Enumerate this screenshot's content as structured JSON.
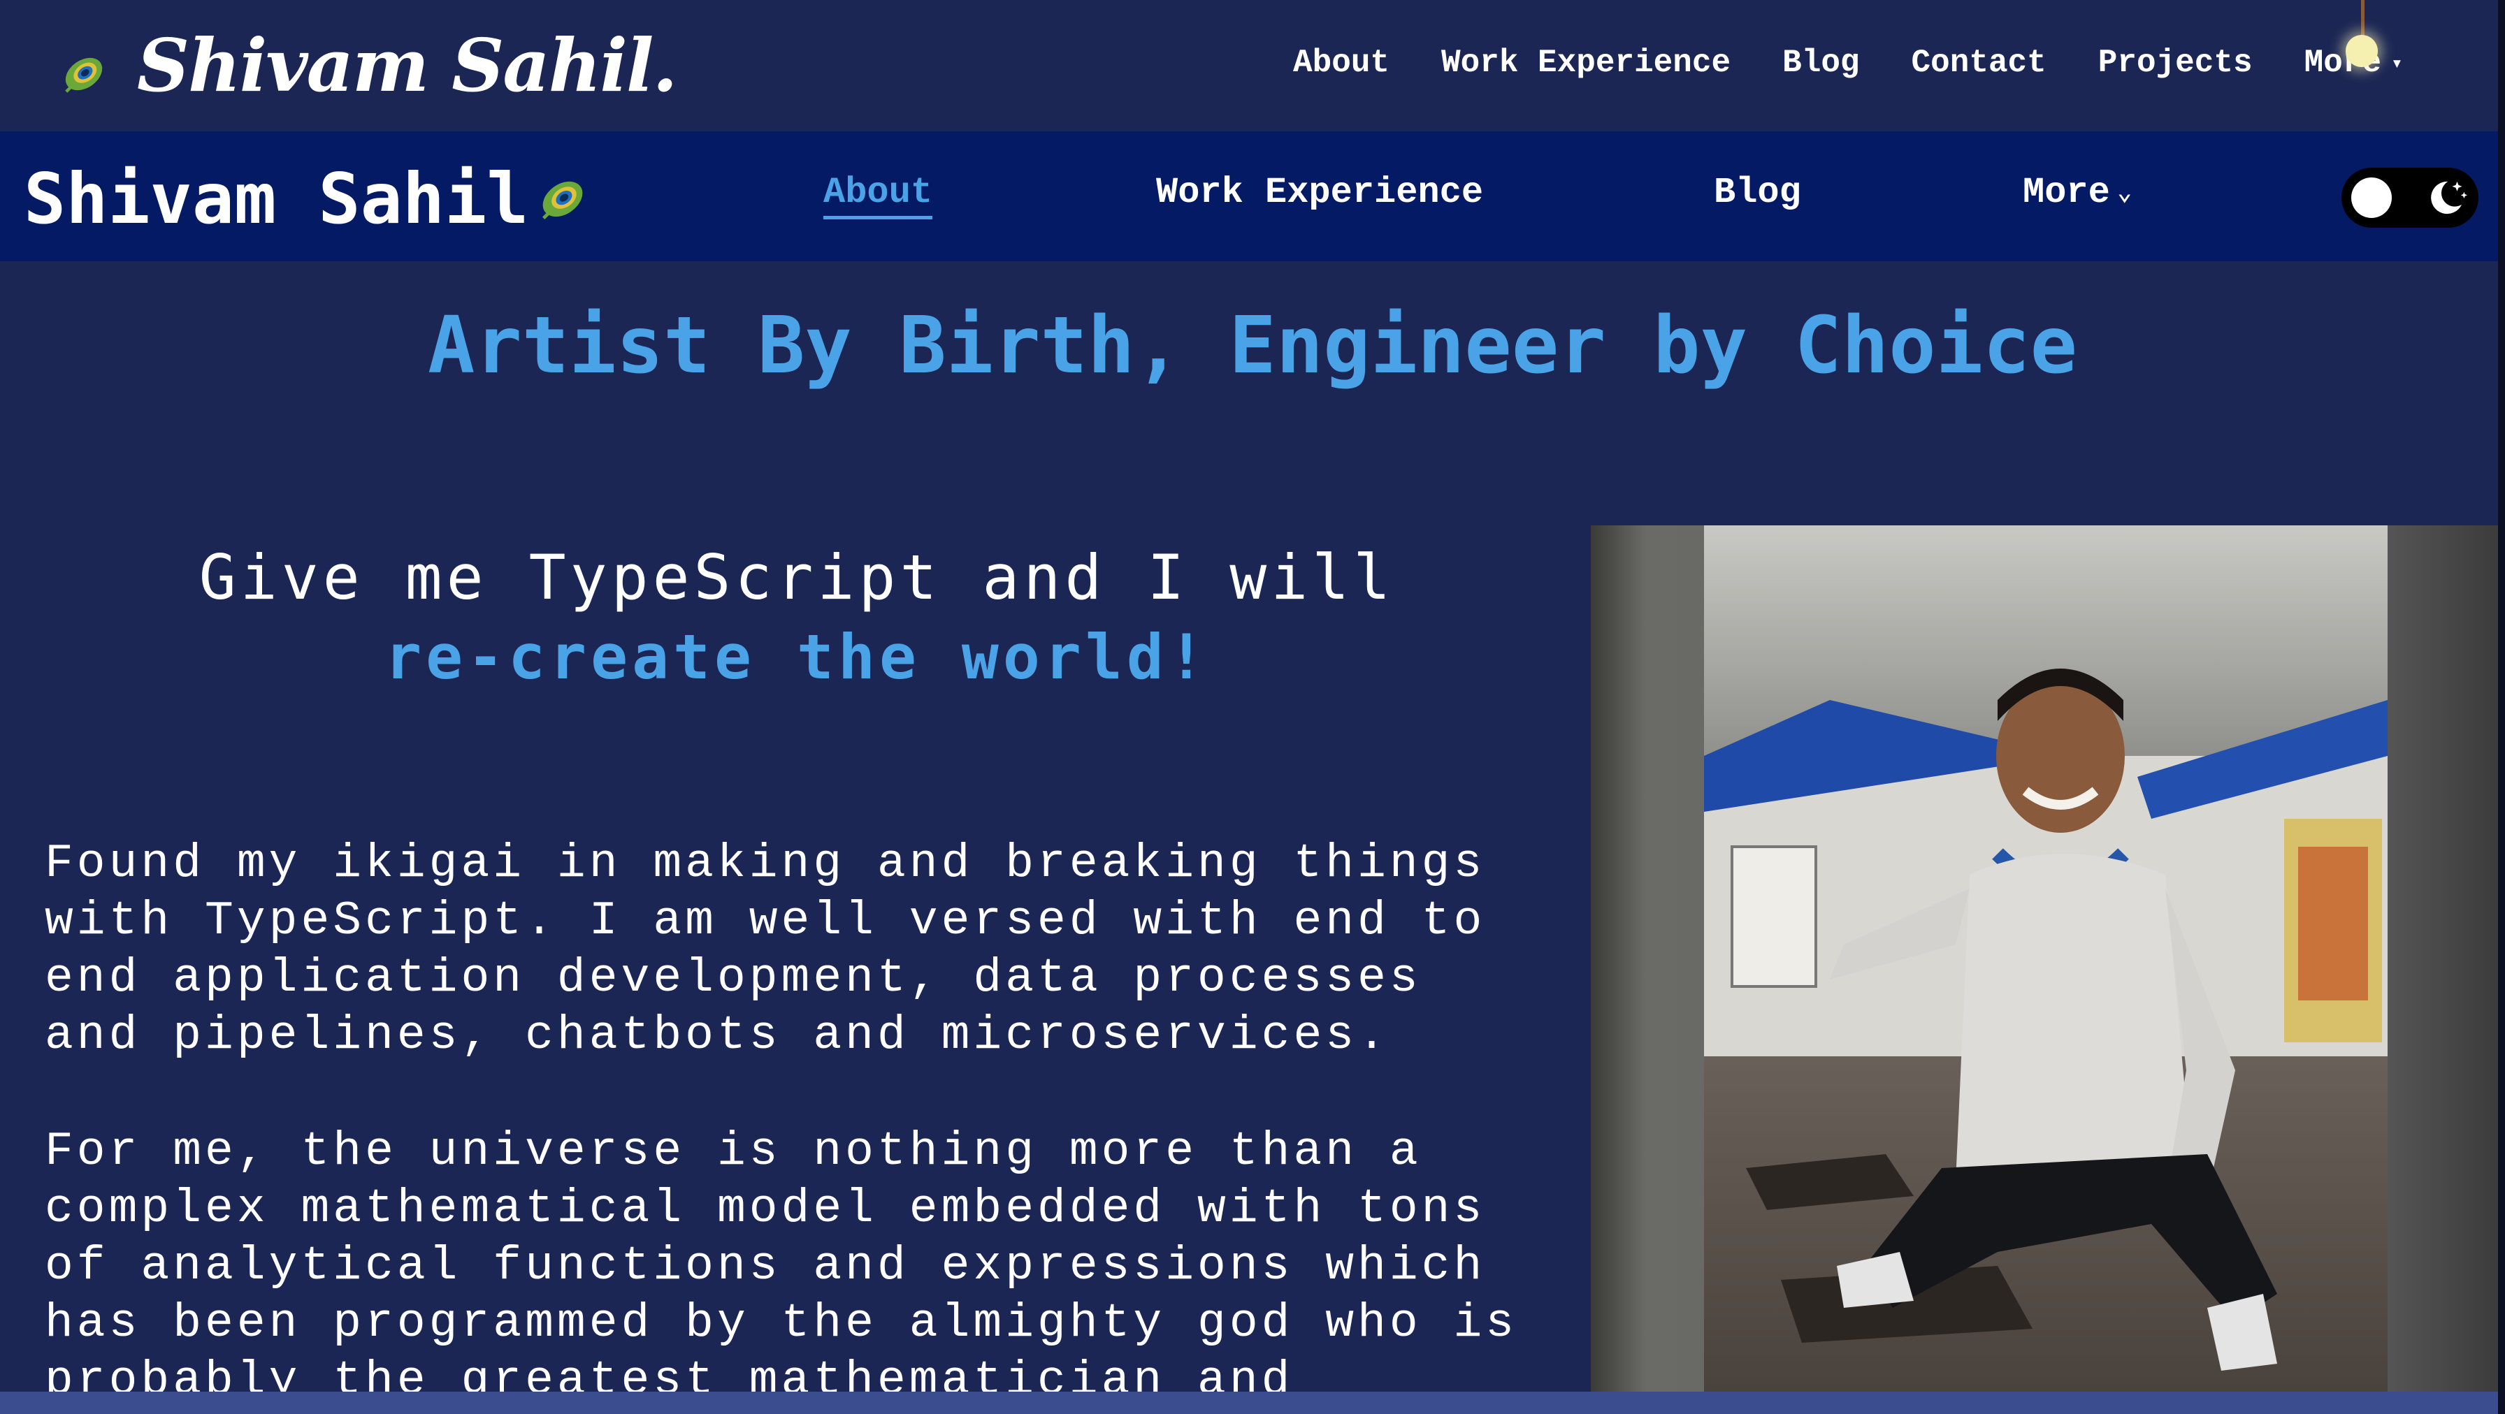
{
  "top_bar": {
    "logo_text": "Shivam Sahil.",
    "nav": [
      "About",
      "Work Experience",
      "Blog",
      "Contact",
      "Projects"
    ],
    "more_label": "More"
  },
  "main_nav": {
    "brand": "Shivam Sahil",
    "links": [
      "About",
      "Work Experience",
      "Blog",
      "More"
    ],
    "active": "About"
  },
  "hero": {
    "title": "Artist By Birth, Engineer by Choice",
    "tagline_line1": "Give me TypeScript and I will",
    "tagline_line2": "re-create the world!"
  },
  "bio": {
    "p1_lines": [
      "Found my ikigai in making and breaking things",
      "with TypeScript. I am well versed with end to",
      "end application development, data processes",
      "and pipelines, chatbots and microservices."
    ],
    "p2_lines": [
      "For me, the universe is nothing more than a",
      "complex mathematical model embedded with tons",
      "of analytical functions and expressions which",
      "has been programmed by the almighty god who is",
      "probably the greatest mathematician and"
    ]
  },
  "colors": {
    "background": "#1b2654",
    "navbar": "#051a64",
    "accent": "#4aa3e6"
  },
  "icons": [
    "peacock-feather-icon",
    "caret-down-icon",
    "chevron-down-icon",
    "moon-stars-icon",
    "lamp-bulb-icon"
  ]
}
